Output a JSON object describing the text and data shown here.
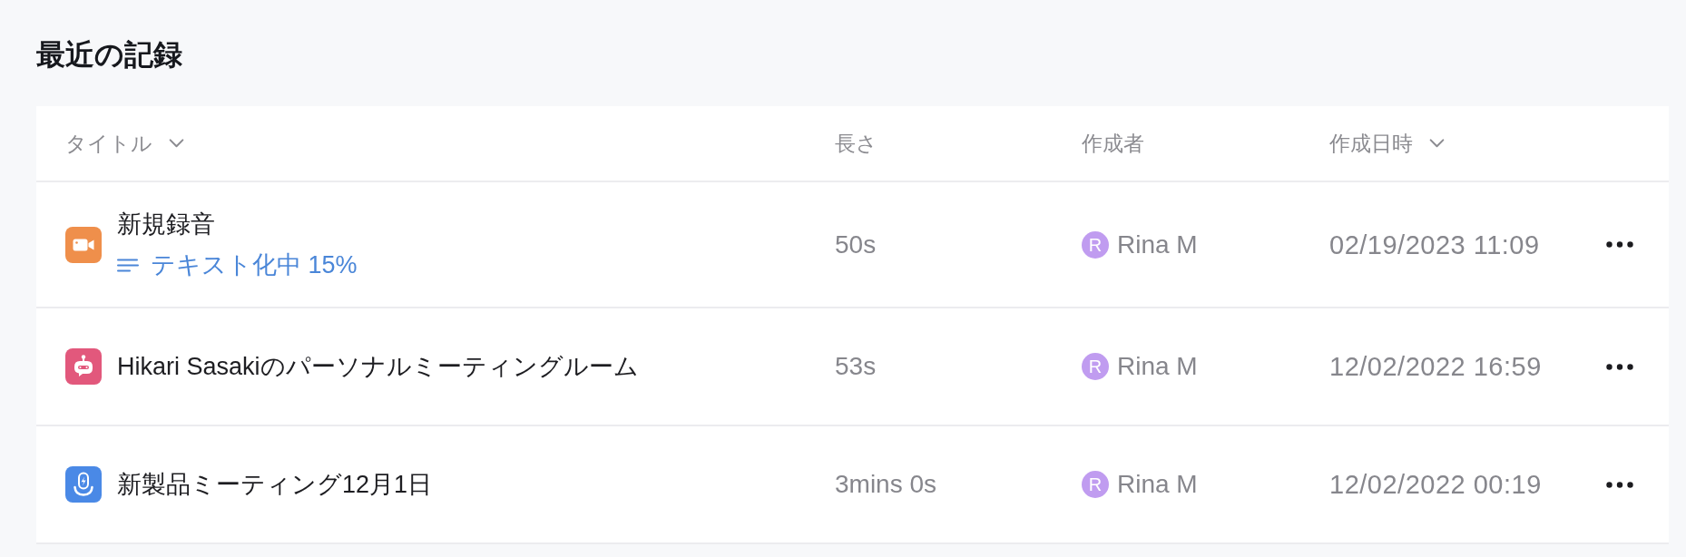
{
  "title": "最近の記録",
  "table": {
    "columns": [
      {
        "label": "タイトル",
        "sortable": true
      },
      {
        "label": "長さ",
        "sortable": false
      },
      {
        "label": "作成者",
        "sortable": false
      },
      {
        "label": "作成日時",
        "sortable": true
      }
    ],
    "rows": [
      {
        "kind": "video",
        "title": "新規録音",
        "status": "テキスト化中 15%",
        "length": "50s",
        "creator": {
          "initial": "R",
          "name": "Rina M"
        },
        "created": "02/19/2023 11:09"
      },
      {
        "kind": "bot",
        "title": "Hikari Sasakiのパーソナルミーティングルーム",
        "length": "53s",
        "creator": {
          "initial": "R",
          "name": "Rina M"
        },
        "created": "12/02/2022 16:59"
      },
      {
        "kind": "mic",
        "title": "新製品ミーティング12月1日",
        "length": "3mins 0s",
        "creator": {
          "initial": "R",
          "name": "Rina M"
        },
        "created": "12/02/2022 00:19"
      }
    ]
  }
}
